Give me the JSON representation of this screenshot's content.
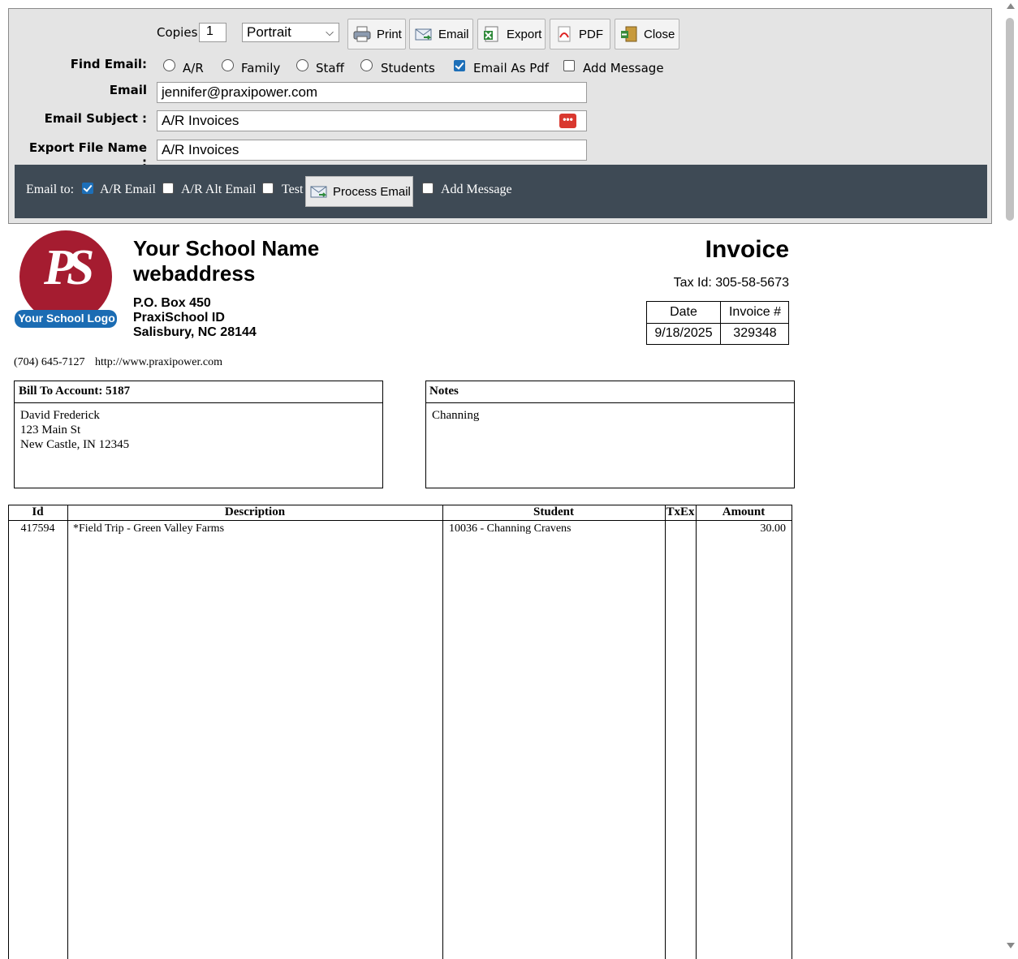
{
  "toolbar": {
    "copies_label": "Copies",
    "copies_value": "1",
    "orientation": "Portrait",
    "print_label": "Print",
    "email_label": "Email",
    "export_label": "Export",
    "pdf_label": "PDF",
    "close_label": "Close"
  },
  "find_email": {
    "label": "Find Email:",
    "options": [
      "A/R",
      "Family",
      "Staff",
      "Students"
    ],
    "email_as_pdf": "Email As Pdf",
    "add_message": "Add Message"
  },
  "form": {
    "email_label": "Email",
    "email_value": "jennifer@praxipower.com",
    "subject_label": "Email Subject :",
    "subject_value": "A/R Invoices",
    "export_label": "Export File Name :",
    "export_value": "A/R Invoices"
  },
  "email_bar": {
    "email_to": "Email to:",
    "ar_email": "A/R Email",
    "ar_alt_email": "A/R Alt Email",
    "test": "Test",
    "process_email": "Process Email",
    "add_message": "Add Message"
  },
  "school": {
    "logo_letters": "PS",
    "logo_text": "Your School Logo",
    "name": "Your School Name",
    "web": "webaddress",
    "addr1": "P.O. Box 450",
    "addr2": "PraxiSchool ID",
    "addr3": "Salisbury, NC 28144",
    "phone": "(704) 645-7127",
    "url": "http://www.praxipower.com"
  },
  "invoice": {
    "title": "Invoice",
    "tax_id": "Tax Id: 305-58-5673",
    "date_label": "Date",
    "number_label": "Invoice #",
    "date": "9/18/2025",
    "number": "329348"
  },
  "bill_to": {
    "header": "Bill To Account: 5187",
    "line1": "David Frederick",
    "line2": "123 Main St",
    "line3": "New Castle, IN 12345"
  },
  "notes": {
    "header": "Notes",
    "text": "Channing"
  },
  "table": {
    "columns": [
      "Id",
      "Description",
      "Student",
      "TxEx",
      "Amount"
    ],
    "rows": [
      {
        "id": "417594",
        "description": "*Field Trip - Green Valley Farms",
        "student": "10036 - Channing Cravens",
        "txex": "",
        "amount": "30.00"
      }
    ]
  }
}
